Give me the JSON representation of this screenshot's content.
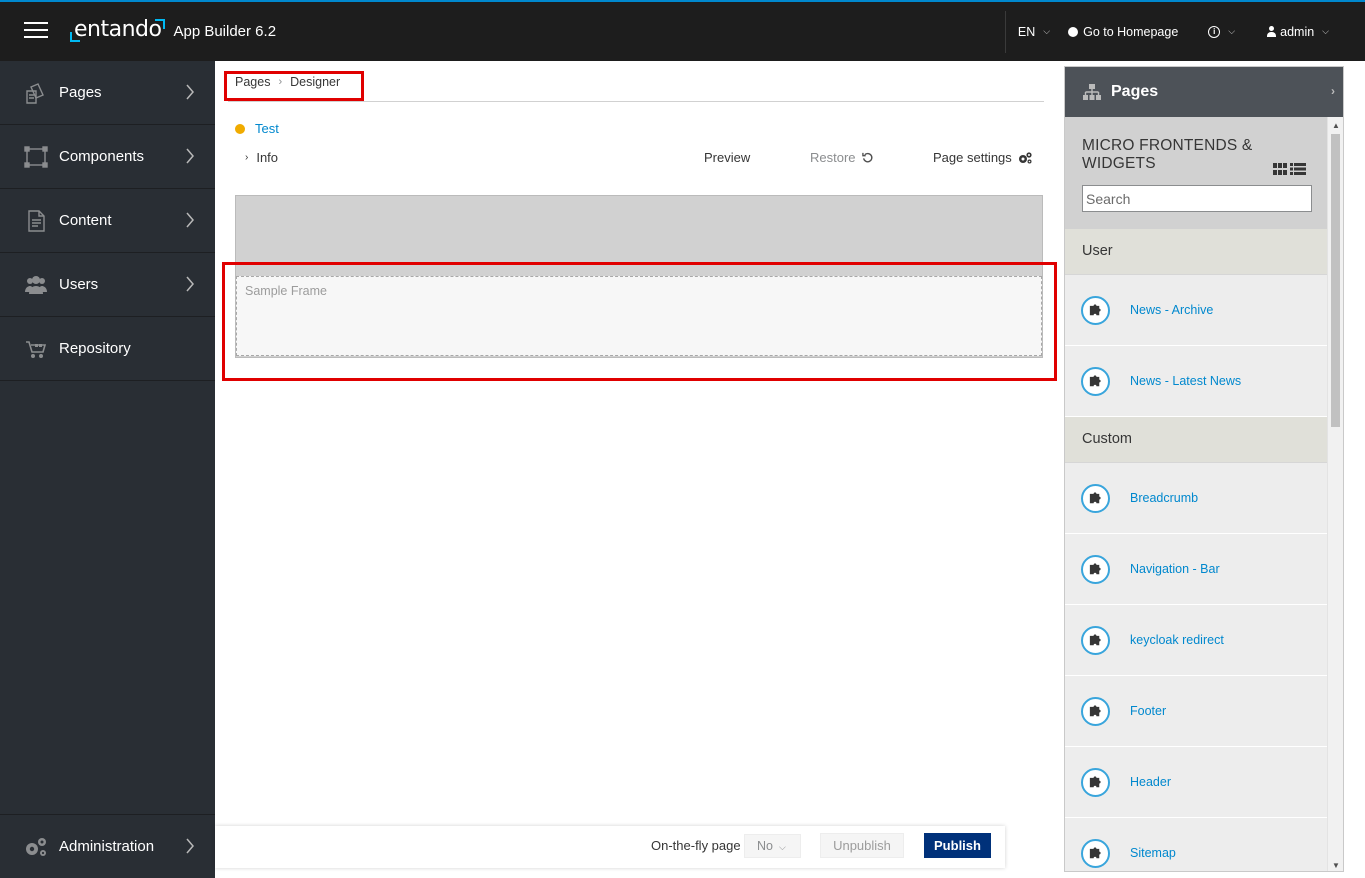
{
  "header": {
    "brand_logo": "entando",
    "app_name": "App Builder 6.2",
    "language": "EN",
    "homepage_link": "Go to Homepage",
    "user": "admin"
  },
  "sidebar": {
    "items": [
      {
        "label": "Pages",
        "icon": "pages-icon"
      },
      {
        "label": "Components",
        "icon": "components-icon"
      },
      {
        "label": "Content",
        "icon": "content-icon"
      },
      {
        "label": "Users",
        "icon": "users-icon"
      },
      {
        "label": "Repository",
        "icon": "repository-icon"
      }
    ],
    "admin_label": "Administration"
  },
  "main": {
    "breadcrumb": [
      "Pages",
      "Designer"
    ],
    "page_name": "Test",
    "info_label": "Info",
    "preview_label": "Preview",
    "restore_label": "Restore",
    "settings_label": "Page settings",
    "frame_label": "Sample Frame"
  },
  "footer": {
    "onthefly_label": "On-the-fly page",
    "onthefly_value": "No",
    "unpublish_label": "Unpublish",
    "publish_label": "Publish"
  },
  "right_panel": {
    "title": "Pages",
    "widgets_title": "MICRO FRONTENDS & WIDGETS",
    "search_placeholder": "Search",
    "sections": [
      {
        "label": "User",
        "items": [
          "News - Archive",
          "News - Latest News"
        ]
      },
      {
        "label": "Custom",
        "items": [
          "Breadcrumb",
          "Navigation - Bar",
          "keycloak redirect",
          "Footer",
          "Header",
          "Sitemap"
        ]
      }
    ]
  },
  "colors": {
    "accent": "#0088ce",
    "highlight": "#e00000",
    "publish": "#00317a",
    "sidebar": "#292e34",
    "topbar": "#1d1d1d"
  }
}
